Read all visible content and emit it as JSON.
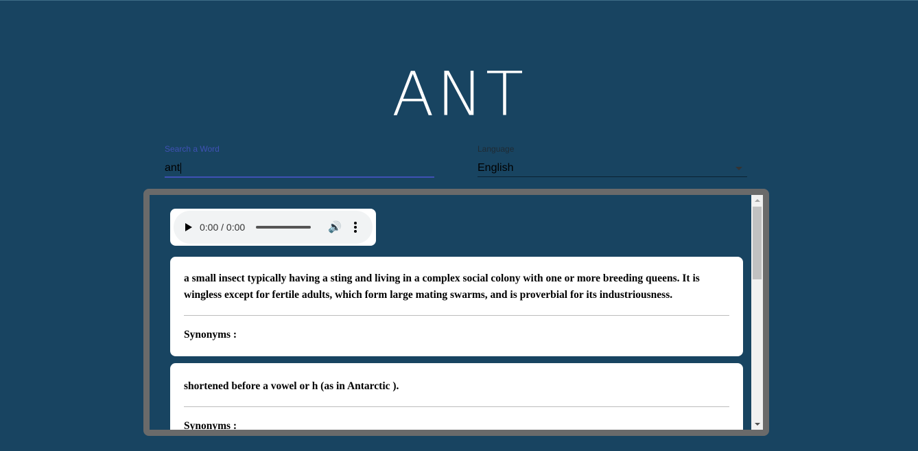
{
  "word_title": "ANT",
  "search": {
    "label": "Search a Word",
    "value": "ant"
  },
  "language": {
    "label": "Language",
    "selected": "English"
  },
  "audio": {
    "time": "0:00 / 0:00"
  },
  "definitions": [
    {
      "text": "a small insect typically having a sting and living in a complex social colony with one or more breeding queens. It is wingless except for fertile adults, which form large mating swarms, and is proverbial for its industriousness.",
      "synonyms_label": "Synonyms :"
    },
    {
      "text": "shortened before a vowel or h (as in Antarctic ).",
      "synonyms_label": "Synonyms :"
    }
  ],
  "colors": {
    "background": "#184461",
    "accent": "#3f51b5",
    "panel_border": "#6a6a6a"
  }
}
